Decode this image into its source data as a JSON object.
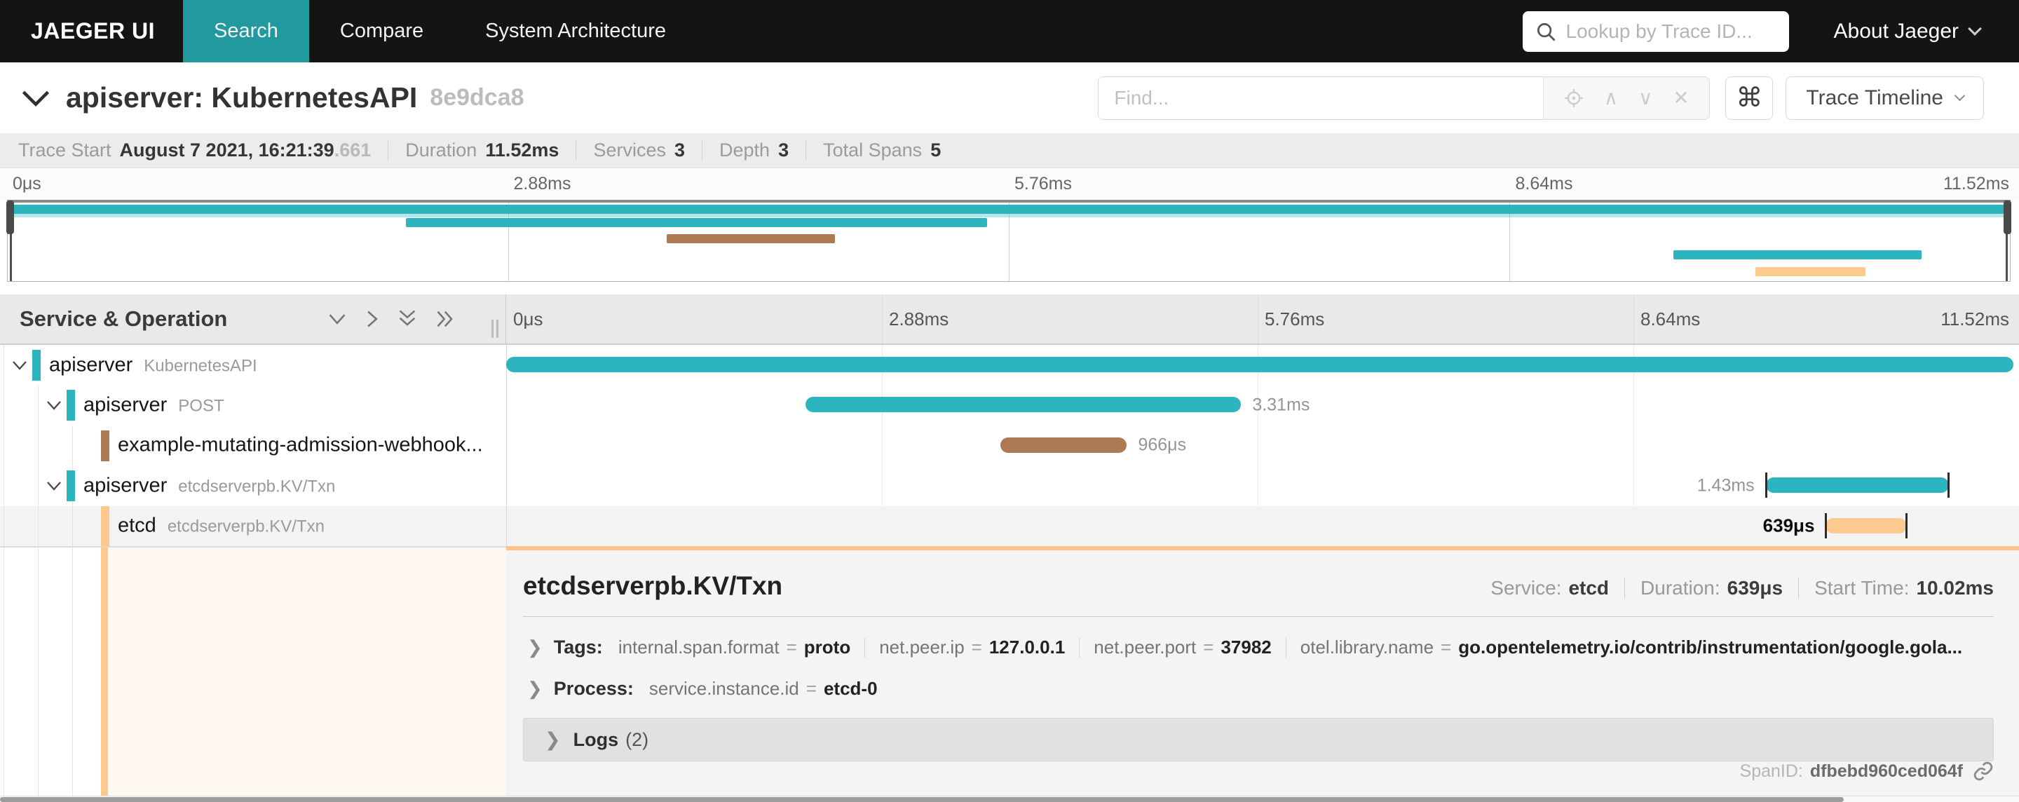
{
  "nav": {
    "brand": "JAEGER UI",
    "tabs": [
      {
        "label": "Search",
        "active": true
      },
      {
        "label": "Compare",
        "active": false
      },
      {
        "label": "System Architecture",
        "active": false
      }
    ],
    "lookup_placeholder": "Lookup by Trace ID...",
    "about_label": "About Jaeger"
  },
  "trace_header": {
    "title": "apiserver: KubernetesAPI",
    "trace_id": "8e9dca8",
    "find_placeholder": "Find...",
    "shortcut_glyph": "⌘",
    "view_button": "Trace Timeline",
    "find_tools": [
      "locate",
      "up",
      "down",
      "clear"
    ]
  },
  "summary": {
    "items": [
      {
        "label": "Trace Start",
        "value": "August 7 2021, 16:21:39",
        "suffix": ".661"
      },
      {
        "label": "Duration",
        "value": "11.52ms",
        "suffix": ""
      },
      {
        "label": "Services",
        "value": "3",
        "suffix": ""
      },
      {
        "label": "Depth",
        "value": "3",
        "suffix": ""
      },
      {
        "label": "Total Spans",
        "value": "5",
        "suffix": ""
      }
    ]
  },
  "timeline": {
    "column_header": "Service & Operation",
    "ticks": [
      "0μs",
      "2.88ms",
      "5.76ms",
      "8.64ms",
      "11.52ms"
    ],
    "total_duration": "11.52ms"
  },
  "colors": {
    "teal": "#2cb5be",
    "brown": "#ad7b53",
    "peach": "#fcc98f",
    "nav_active": "#20999f",
    "detail_accent": "#fdc58c"
  },
  "minimap": {
    "bars": [
      {
        "row": 0,
        "start_pct": 0,
        "width_pct": 100,
        "color": "#2cb5be"
      },
      {
        "row": 1,
        "start_pct": 19.9,
        "width_pct": 29.0,
        "color": "#2cb5be"
      },
      {
        "row": 2,
        "start_pct": 32.9,
        "width_pct": 8.4,
        "color": "#ad7b53"
      },
      {
        "row": 3,
        "start_pct": 83.2,
        "width_pct": 12.4,
        "color": "#2cb5be"
      },
      {
        "row": 4,
        "start_pct": 87.3,
        "width_pct": 5.5,
        "color": "#fcc98f"
      }
    ]
  },
  "spans": [
    {
      "service": "apiserver",
      "operation": "KubernetesAPI",
      "depth": 0,
      "has_children": true,
      "color": "#2cb5be",
      "start_pct": 0,
      "width_pct": 100.3,
      "duration_label": "",
      "label_side": "right",
      "edge_ticks": false,
      "selected": false
    },
    {
      "service": "apiserver",
      "operation": "POST",
      "depth": 1,
      "has_children": true,
      "color": "#2cb5be",
      "start_pct": 19.9,
      "width_pct": 29.0,
      "duration_label": "3.31ms",
      "label_side": "right",
      "edge_ticks": false,
      "selected": false
    },
    {
      "service": "example-mutating-admission-webhook...",
      "operation": "",
      "depth": 2,
      "has_children": false,
      "color": "#ad7b53",
      "start_pct": 32.9,
      "width_pct": 8.4,
      "duration_label": "966μs",
      "label_side": "right",
      "edge_ticks": false,
      "selected": false
    },
    {
      "service": "apiserver",
      "operation": "etcdserverpb.KV/Txn",
      "depth": 1,
      "has_children": true,
      "color": "#2cb5be",
      "start_pct": 83.8,
      "width_pct": 12.2,
      "duration_label": "1.43ms",
      "label_side": "left",
      "edge_ticks": true,
      "selected": false
    },
    {
      "service": "etcd",
      "operation": "etcdserverpb.KV/Txn",
      "depth": 2,
      "has_children": false,
      "color": "#fcc98f",
      "start_pct": 87.8,
      "width_pct": 5.4,
      "duration_label": "639μs",
      "label_side": "left",
      "edge_ticks": true,
      "selected": true
    }
  ],
  "detail": {
    "operation": "etcdserverpb.KV/Txn",
    "service_label": "Service:",
    "service": "etcd",
    "duration_label": "Duration:",
    "duration": "639μs",
    "start_label": "Start Time:",
    "start_time": "10.02ms",
    "tags_label": "Tags:",
    "tags": [
      {
        "key": "internal.span.format",
        "value": "proto"
      },
      {
        "key": "net.peer.ip",
        "value": "127.0.0.1"
      },
      {
        "key": "net.peer.port",
        "value": "37982"
      },
      {
        "key": "otel.library.name",
        "value": "go.opentelemetry.io/contrib/instrumentation/google.gola..."
      }
    ],
    "process_label": "Process:",
    "process": [
      {
        "key": "service.instance.id",
        "value": "etcd-0"
      }
    ],
    "logs_label": "Logs",
    "logs_count": "(2)",
    "spanid_label": "SpanID:",
    "spanid": "dfbebd960ced064f"
  }
}
